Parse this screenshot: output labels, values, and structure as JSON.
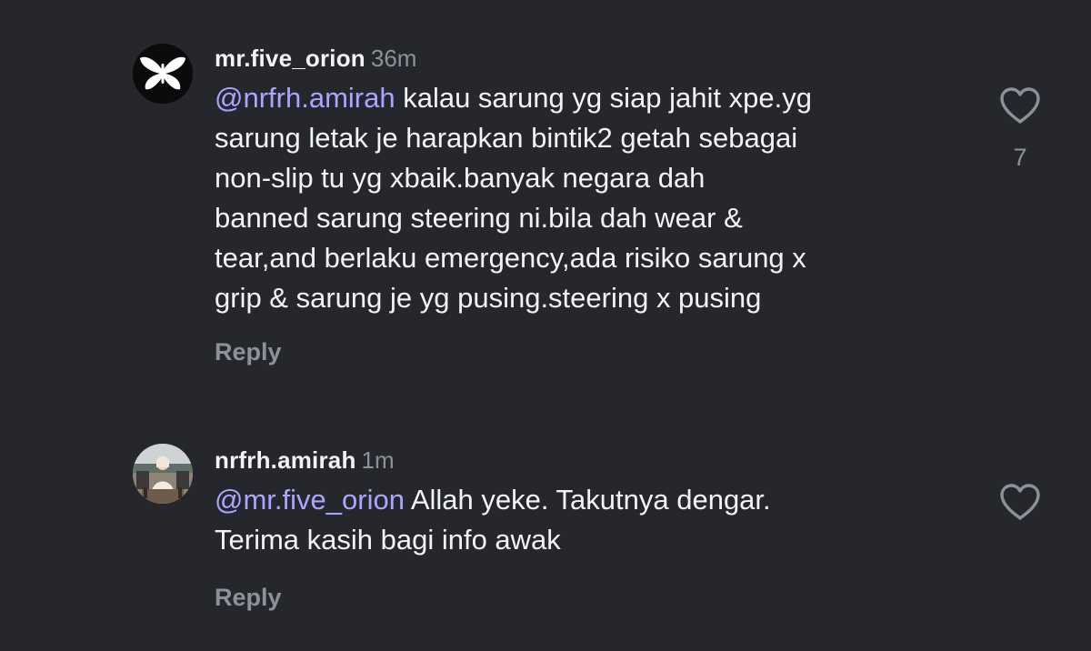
{
  "comments": [
    {
      "username": "mr.five_orion",
      "time": "36m",
      "mention": "@nrfrh.amirah",
      "lines": [
        " kalau sarung yg siap jahit xpe.yg",
        "sarung letak je harapkan bintik2 getah sebagai",
        "non-slip tu yg xbaik.banyak negara dah",
        "banned sarung steering ni.bila dah wear &",
        "tear,and berlaku emergency,ada risiko sarung x",
        "grip & sarung je yg pusing.steering x pusing"
      ],
      "reply_label": "Reply",
      "like_count": "7",
      "avatar_icon": "butterfly-avatar-icon"
    },
    {
      "username": "nrfrh.amirah",
      "time": "1m",
      "mention": "@mr.five_orion",
      "lines": [
        " Allah yeke. Takutnya dengar.",
        "Terima kasih bagi info awak"
      ],
      "reply_label": "Reply",
      "avatar_icon": "profile-photo-avatar-icon"
    }
  ],
  "colors": {
    "background": "#25272c",
    "text": "#f2f3f5",
    "secondary": "#8e9197",
    "mention": "#a9a6ff"
  },
  "icons": {
    "like": "heart-outline-icon"
  }
}
